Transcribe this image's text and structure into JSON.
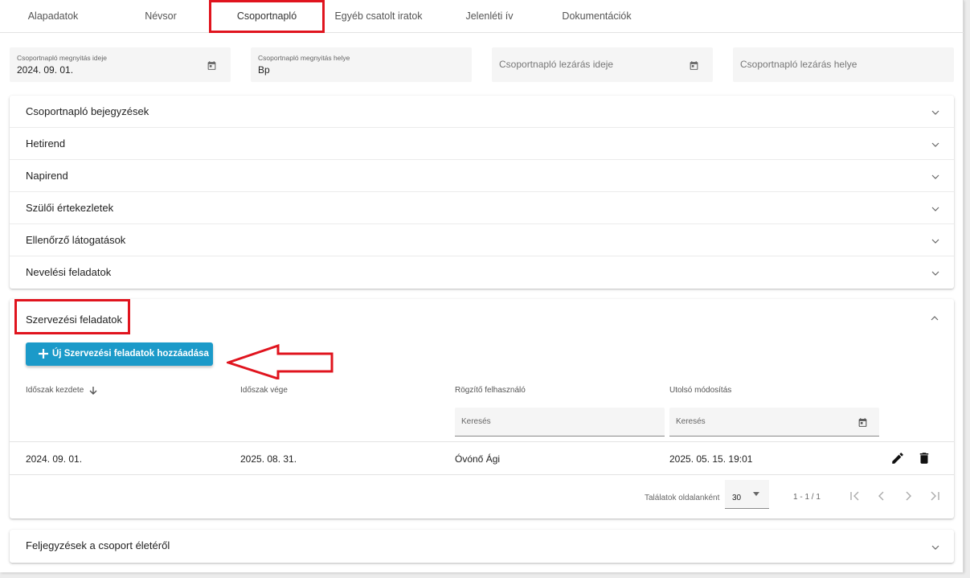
{
  "tabs": [
    {
      "label": "Alapadatok"
    },
    {
      "label": "Névsor"
    },
    {
      "label": "Csoportnapló"
    },
    {
      "label": "Egyéb csatolt iratok"
    },
    {
      "label": "Jelenléti ív"
    },
    {
      "label": "Dokumentációk"
    }
  ],
  "header_fields": {
    "open_date": {
      "label": "Csoportnapló megnyitás ideje",
      "value": "2024. 09. 01."
    },
    "open_place": {
      "label": "Csoportnapló megnyitás helye",
      "value": "Bp"
    },
    "close_date": {
      "placeholder": "Csoportnapló lezárás ideje"
    },
    "close_place": {
      "placeholder": "Csoportnapló lezárás helye"
    }
  },
  "accordion": [
    {
      "title": "Csoportnapló bejegyzések"
    },
    {
      "title": "Hetirend"
    },
    {
      "title": "Napirend"
    },
    {
      "title": "Szülői értekezletek"
    },
    {
      "title": "Ellenőrző látogatások"
    },
    {
      "title": "Nevelési feladatok"
    }
  ],
  "section": {
    "title": "Szervezési feladatok",
    "add_button": "Új Szervezési feladatok hozzáadása",
    "columns": [
      "Időszak kezdete",
      "Időszak vége",
      "Rögzítő felhasználó",
      "Utolsó módosítás"
    ],
    "filter_placeholder": "Keresés",
    "rows": [
      [
        "2024. 09. 01.",
        "2025. 08. 31.",
        "Óvónő Ági",
        "2025. 05. 15. 19:01"
      ]
    ],
    "pager": {
      "per_page_label": "Találatok oldalanként",
      "per_page": "30",
      "range": "1 - 1 / 1"
    }
  },
  "footer_accordion": {
    "title": "Feljegyzések a csoport életéről"
  },
  "colors": {
    "accent": "#1b9ac9",
    "highlight": "#e0141e"
  },
  "icons": [
    "calendar-icon",
    "chevron-down-icon",
    "chevron-up-icon",
    "plus-icon",
    "arrow-down-icon",
    "edit-icon",
    "delete-icon",
    "first-page-icon",
    "previous-page-icon",
    "next-page-icon",
    "last-page-icon",
    "callout-arrow"
  ]
}
